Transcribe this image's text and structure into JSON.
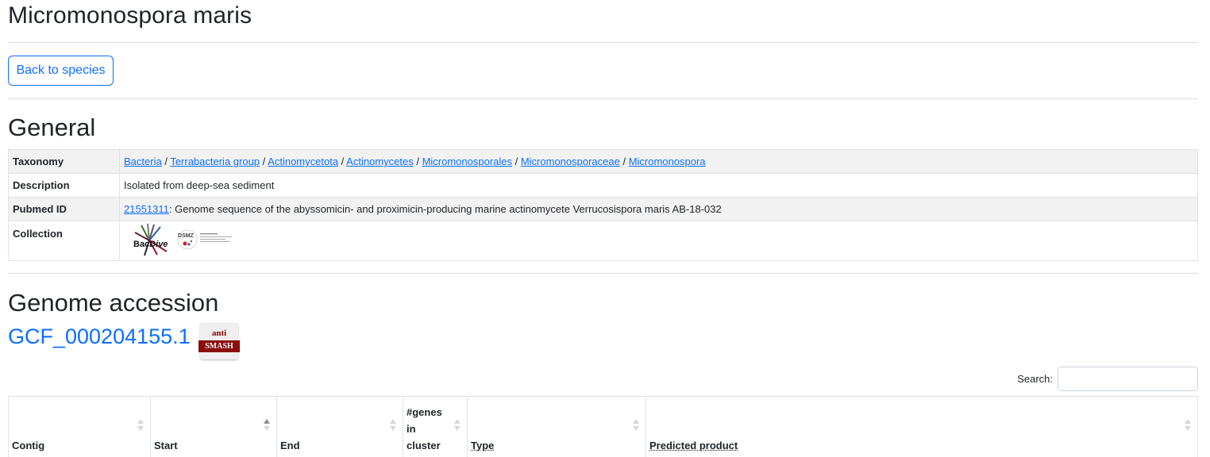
{
  "page": {
    "title": "Micromonospora maris",
    "back_button": "Back to species"
  },
  "general": {
    "heading": "General",
    "rows": {
      "taxonomy": {
        "label": "Taxonomy",
        "links": [
          "Bacteria",
          "Terrabacteria group",
          "Actinomycetota",
          "Actinomycetes",
          "Micromonosporales",
          "Micromonosporaceae",
          "Micromonospora"
        ],
        "separator": " / "
      },
      "description": {
        "label": "Description",
        "value": "Isolated from deep-sea sediment"
      },
      "pubmed": {
        "label": "Pubmed ID",
        "id": "21551311",
        "text": ": Genome sequence of the abyssomicin- and proximicin-producing marine actinomycete Verrucosispora maris AB-18-032"
      },
      "collection": {
        "label": "Collection",
        "logos": [
          "BacDive",
          "DSMZ"
        ]
      }
    }
  },
  "genome": {
    "heading": "Genome accession",
    "accession": "GCF_000204155.1",
    "antismash": {
      "top": "anti",
      "bottom": "SMASH"
    }
  },
  "search": {
    "label": "Search:",
    "value": "",
    "placeholder": ""
  },
  "clusters_table": {
    "columns": [
      {
        "label": "Contig",
        "sort": "none"
      },
      {
        "label": "Start",
        "sort": "asc"
      },
      {
        "label": "End",
        "sort": "none"
      },
      {
        "label": "#genes in cluster",
        "sort": "none"
      },
      {
        "label": "Type",
        "sort": "none"
      },
      {
        "label": "Predicted product",
        "sort": "none"
      }
    ]
  },
  "colors": {
    "link": "#0d6efd",
    "antismash_red": "#8b0a0a",
    "stripe": "#f2f2f2"
  }
}
